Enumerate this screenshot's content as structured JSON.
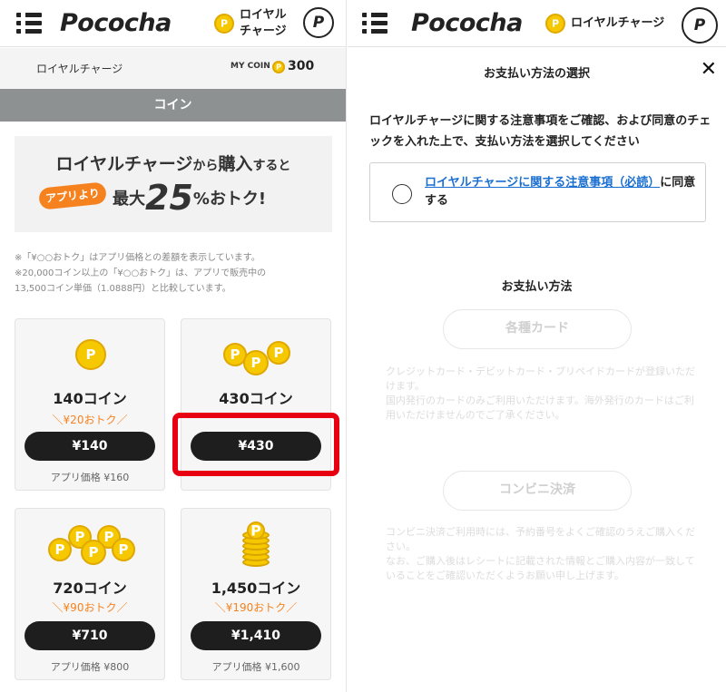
{
  "app": {
    "logo": "Pococha",
    "header_label": "ロイヤル\nチャージ",
    "header_label_oneline": "ロイヤルチャージ",
    "profile_letter": "P"
  },
  "left": {
    "subbar_title": "ロイヤルチャージ",
    "my_coin_label": "MY COIN",
    "my_coin_value": "300",
    "tab_label": "コイン",
    "promo": {
      "line1_a": "ロイヤルチャージ",
      "line1_b": "から",
      "line1_c": "購入",
      "line1_d": "すると",
      "badge": "アプリより",
      "line2_a": "最大",
      "line2_num": "25",
      "line2_pct": "%",
      "line2_b": "おトク!"
    },
    "notes": [
      "※「¥○○おトク」はアプリ価格との差額を表示しています。",
      "※20,000コイン以上の「¥○○おトク」は、アプリで販売中の",
      "13,500コイン単価（1.0888円）と比較しています。"
    ],
    "packages": [
      {
        "name": "140コイン",
        "discount": "＼¥20おトク／",
        "price": "¥140",
        "app_price": "アプリ価格 ¥160"
      },
      {
        "name": "430コイン",
        "discount": "",
        "price": "¥430",
        "app_price": ""
      },
      {
        "name": "720コイン",
        "discount": "＼¥90おトク／",
        "price": "¥710",
        "app_price": "アプリ価格 ¥800"
      },
      {
        "name": "1,450コイン",
        "discount": "＼¥190おトク／",
        "price": "¥1,410",
        "app_price": "アプリ価格 ¥1,600"
      }
    ]
  },
  "right": {
    "title": "お支払い方法の選択",
    "close_glyph": "✕",
    "intro": "ロイヤルチャージに関する注意事項をご確認、および同意のチェックを入れた上で、支払い方法を選択してください",
    "consent_link": "ロイヤルチャージに関する注意事項（必読）",
    "consent_rest": "に同意する",
    "pay_heading": "お支払い方法",
    "card_button": "各種カード",
    "card_note": "クレジットカード・デビットカード・プリペイドカードが登録いただけます。\n国内発行のカードのみご利用いただけます。海外発行のカードはご利用いただけませんのでご了承ください。",
    "konbini_button": "コンビニ決済",
    "konbini_note": "コンビニ決済ご利用時には、予約番号をよくご確認のうえご購入ください。\nなお、ご購入後はレシートに記載された情報とご購入内容が一致していることをご確認いただくようお願い申し上げます。"
  },
  "colors": {
    "accent_orange": "#f5821f",
    "coin_gold": "#f6c800",
    "highlight_red": "#e60012",
    "link_blue": "#1a6fd1"
  }
}
